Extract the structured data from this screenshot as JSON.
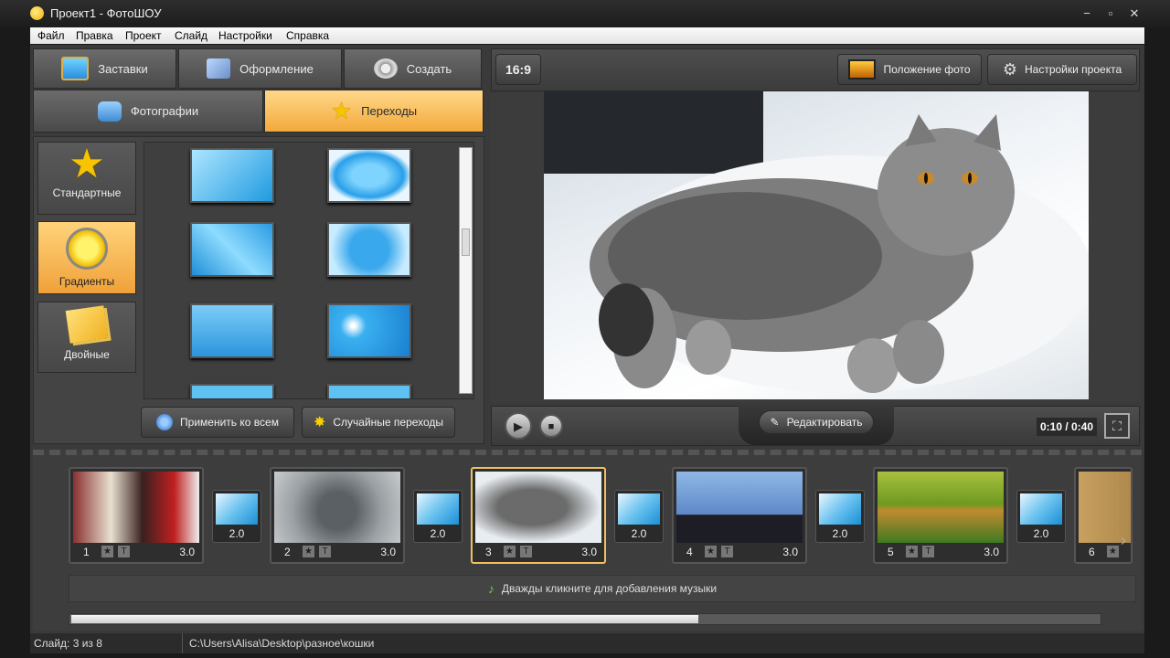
{
  "window": {
    "title": "Проект1 - ФотоШОУ",
    "minimize": "−",
    "maximize": "▫",
    "close": "✕"
  },
  "menu": [
    "Файл",
    "Правка",
    "Проект",
    "Слайд",
    "Настройки",
    "Справка"
  ],
  "tabs": {
    "top": [
      "Заставки",
      "Оформление",
      "Создать"
    ],
    "second": [
      "Фотографии",
      "Переходы"
    ],
    "active_second": "Переходы"
  },
  "categories": [
    {
      "label": "Стандартные",
      "icon": "star-icon"
    },
    {
      "label": "Градиенты",
      "icon": "gradient-sun-icon"
    },
    {
      "label": "Двойные",
      "icon": "double-icon"
    }
  ],
  "active_category": "Градиенты",
  "transition_grid": [
    "gradient-tiles",
    "gradient-sphere",
    "gradient-shards",
    "gradient-splash",
    "gradient-frost",
    "gradient-sparkle",
    "gradient-7",
    "gradient-8"
  ],
  "buttons": {
    "apply_all": "Применить ко всем",
    "random": "Случайные переходы"
  },
  "preview": {
    "aspect": "16:9",
    "photo_position": "Положение фото",
    "project_settings": "Настройки проекта",
    "edit": "Редактировать",
    "time": "0:10 / 0:40"
  },
  "timeline": {
    "slides": [
      {
        "num": "1",
        "dur": "3.0",
        "star": "★",
        "text": "T"
      },
      {
        "num": "2",
        "dur": "3.0",
        "star": "★",
        "text": "T"
      },
      {
        "num": "3",
        "dur": "3.0",
        "star": "★",
        "text": "T"
      },
      {
        "num": "4",
        "dur": "3.0",
        "star": "★",
        "text": "T"
      },
      {
        "num": "5",
        "dur": "3.0",
        "star": "★",
        "text": "T"
      },
      {
        "num": "6",
        "dur": "",
        "star": "★",
        "text": ""
      }
    ],
    "transitions": [
      "2.0",
      "2.0",
      "2.0",
      "2.0",
      "2.0"
    ],
    "music_hint": "Дважды кликните для добавления музыки"
  },
  "status": {
    "slide": "Слайд: 3 из 8",
    "path": "C:\\Users\\Alisa\\Desktop\\разное\\кошки"
  },
  "colors": {
    "accent": "#f3a93a",
    "bg": "#3a3a3a"
  }
}
